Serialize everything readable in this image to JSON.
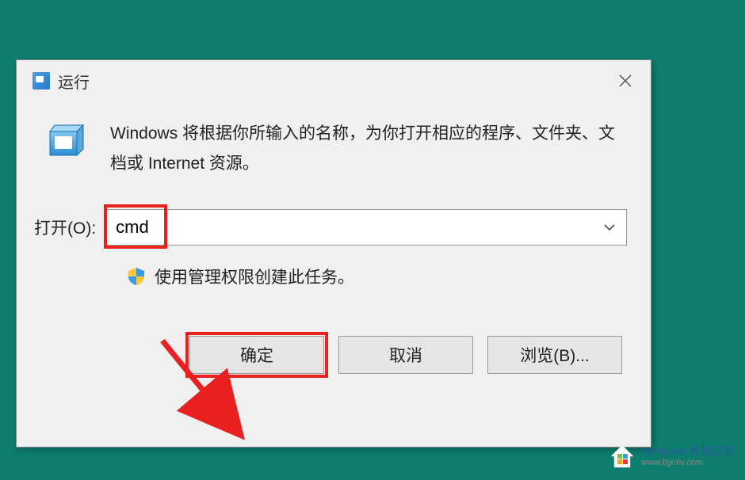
{
  "dialog": {
    "title": "运行",
    "description": "Windows 将根据你所输入的名称，为你打开相应的程序、文件夹、文档或 Internet 资源。",
    "open_label": "打开(O):",
    "input_value": "cmd",
    "admin_note": "使用管理权限创建此任务。",
    "buttons": {
      "ok": "确定",
      "cancel": "取消",
      "browse": "浏览(B)..."
    }
  },
  "watermark": {
    "title": "Windows 系统之家",
    "url": "www.bjjmlv.com"
  }
}
